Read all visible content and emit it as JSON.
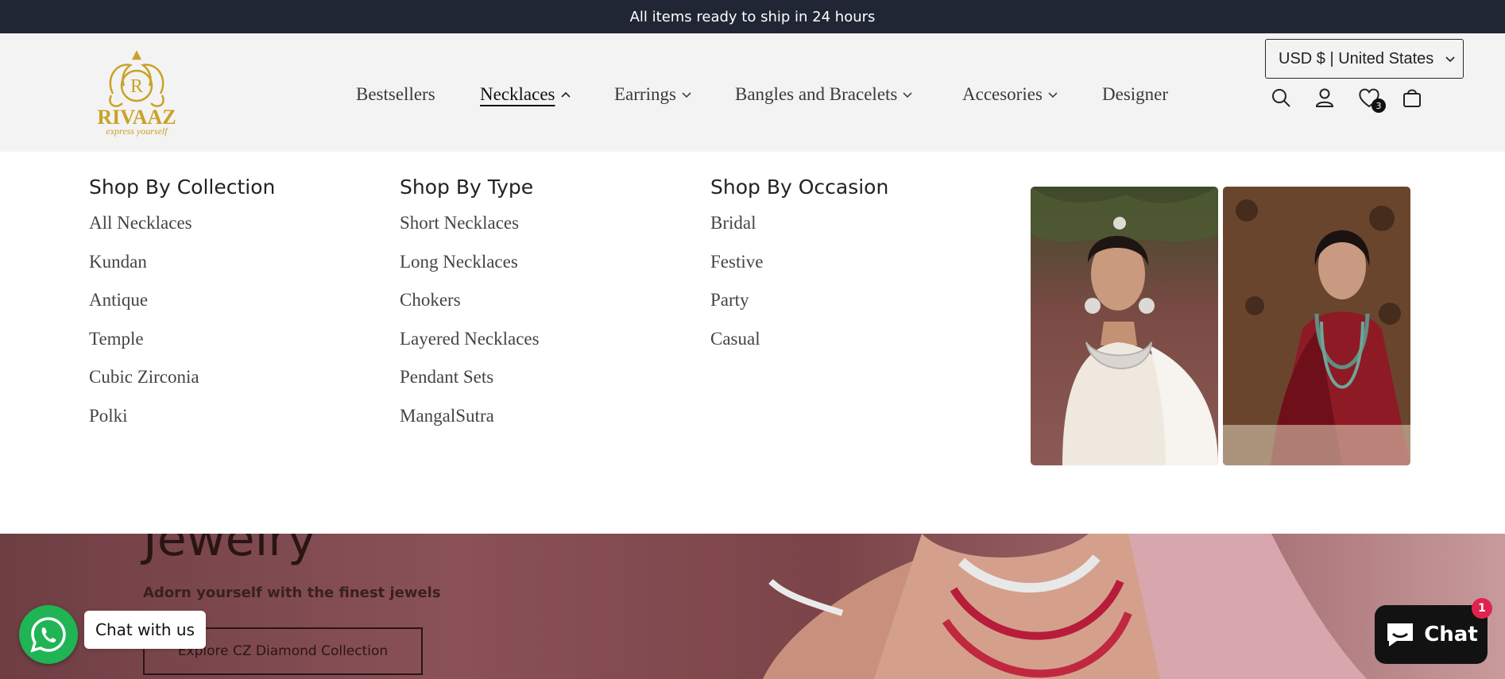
{
  "announcement": "All items ready to ship in 24 hours",
  "brand": {
    "name": "RIVAAZ",
    "tagline": "express yourself",
    "monogram": "R",
    "color": "#c9a227"
  },
  "nav": [
    {
      "label": "Bestsellers"
    },
    {
      "label": "Necklaces",
      "active": true
    },
    {
      "label": "Earrings"
    },
    {
      "label": "Bangles and Bracelets"
    },
    {
      "label": "Accesories"
    },
    {
      "label": "Designer"
    }
  ],
  "currency": {
    "value": "USD $ | United States"
  },
  "icons": {
    "search": "search-icon",
    "account": "user-icon",
    "wishlist": "heart-icon",
    "cart": "bag-icon"
  },
  "wishlist_count": "3",
  "mega_menu": {
    "columns": [
      {
        "title": "Shop By Collection",
        "items": [
          "All Necklaces",
          "Kundan",
          "Antique",
          "Temple",
          "Cubic Zirconia",
          "Polki"
        ]
      },
      {
        "title": "Shop By Type",
        "items": [
          "Short Necklaces",
          "Long Necklaces",
          "Chokers",
          "Layered Necklaces",
          "Pendant Sets",
          "MangalSutra"
        ]
      },
      {
        "title": "Shop By Occasion",
        "items": [
          "Bridal",
          "Festive",
          "Party",
          "Casual"
        ]
      }
    ]
  },
  "hero": {
    "title": "Jewelry",
    "subtitle": "Adorn yourself with the finest jewels",
    "button": "Explore CZ Diamond Collection"
  },
  "whatsapp": {
    "label": "Chat with us",
    "color": "#1fb454"
  },
  "chat": {
    "label": "Chat",
    "badge": "1",
    "badge_color": "#e0234e"
  }
}
